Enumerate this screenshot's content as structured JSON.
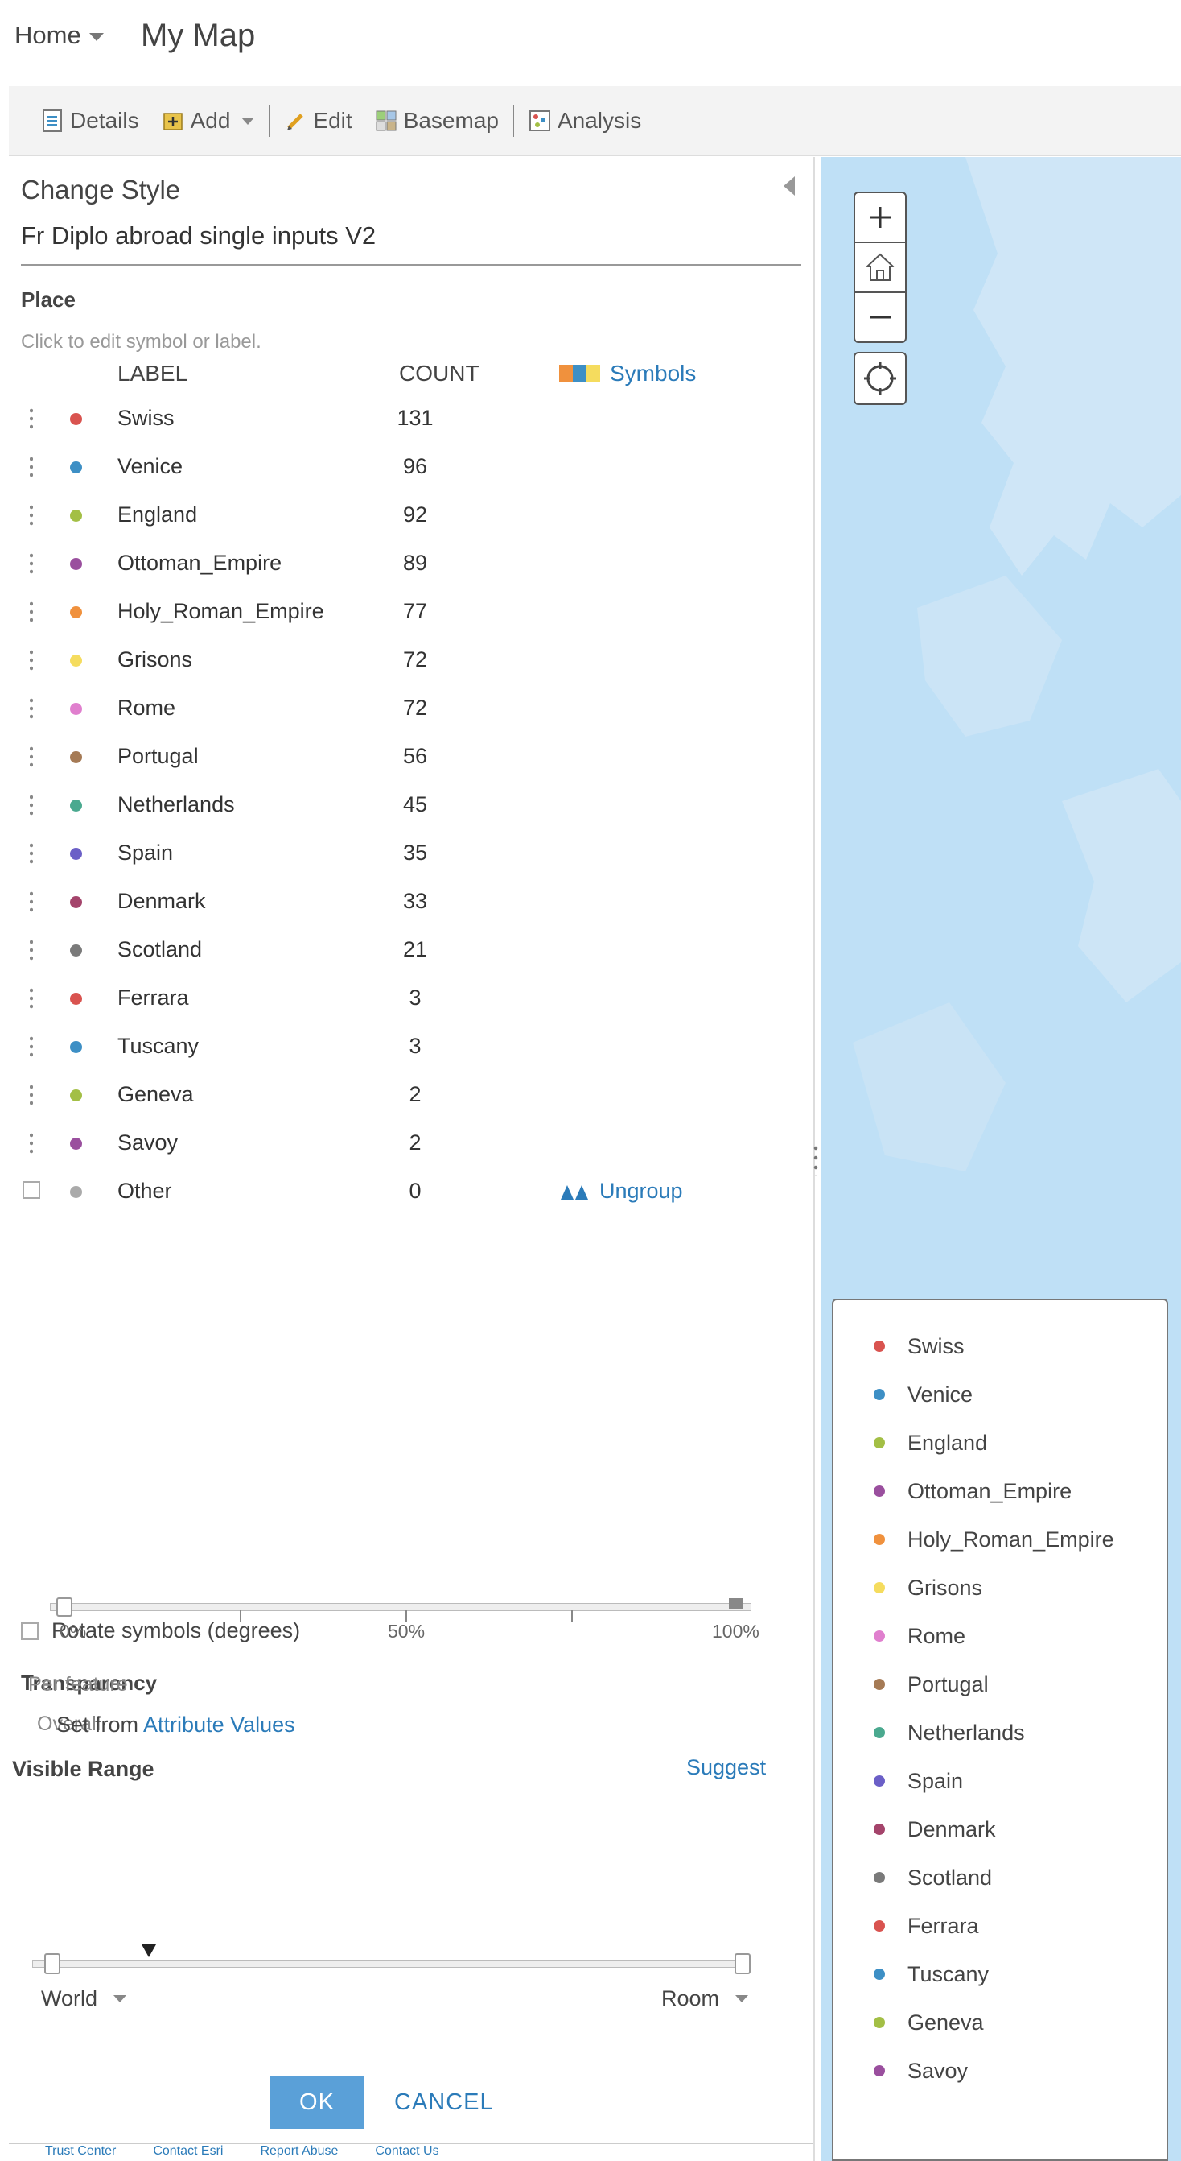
{
  "header": {
    "home": "Home",
    "title": "My Map"
  },
  "toolbar": {
    "details": "Details",
    "add": "Add",
    "edit": "Edit",
    "basemap": "Basemap",
    "analysis": "Analysis"
  },
  "panel": {
    "heading": "Change Style",
    "layer_name": "Fr Diplo abroad single inputs V2",
    "attribute": "Place",
    "hint": "Click to edit symbol or label.",
    "col_label": "LABEL",
    "col_count": "COUNT",
    "symbols": "Symbols",
    "ungroup": "Ungroup",
    "categories": [
      {
        "label": "Swiss",
        "count": "131",
        "color": "#d9534f"
      },
      {
        "label": "Venice",
        "count": "96",
        "color": "#3d8fc5"
      },
      {
        "label": "England",
        "count": "92",
        "color": "#a3bf45"
      },
      {
        "label": "Ottoman_Empire",
        "count": "89",
        "color": "#9a4f9e"
      },
      {
        "label": "Holy_Roman_Empire",
        "count": "77",
        "color": "#f0913d"
      },
      {
        "label": "Grisons",
        "count": "72",
        "color": "#f5dc5e"
      },
      {
        "label": "Rome",
        "count": "72",
        "color": "#e07fce"
      },
      {
        "label": "Portugal",
        "count": "56",
        "color": "#a57a55"
      },
      {
        "label": "Netherlands",
        "count": "45",
        "color": "#4aa98f"
      },
      {
        "label": "Spain",
        "count": "35",
        "color": "#6b5fc7"
      },
      {
        "label": "Denmark",
        "count": "33",
        "color": "#a4446b"
      },
      {
        "label": "Scotland",
        "count": "21",
        "color": "#7a7a7a"
      },
      {
        "label": "Ferrara",
        "count": "3",
        "color": "#d9534f"
      },
      {
        "label": "Tuscany",
        "count": "3",
        "color": "#3d8fc5"
      },
      {
        "label": "Geneva",
        "count": "2",
        "color": "#a3bf45"
      },
      {
        "label": "Savoy",
        "count": "2",
        "color": "#9a4f9e"
      }
    ],
    "other": {
      "label": "Other",
      "count": "0",
      "color": "#aaaaaa"
    },
    "rotate": "Rotate symbols (degrees)",
    "transparency": "Transparency",
    "overall": "Overall",
    "overall_value_pct": 0,
    "pct_labels": [
      "0%",
      "50%",
      "100%"
    ],
    "per_feature": "Per feature",
    "set_from": "Set from",
    "attribute_values": "Attribute Values",
    "visible_range": "Visible Range",
    "suggest": "Suggest",
    "range_min": "World",
    "range_max": "Room",
    "ok": "OK",
    "cancel": "CANCEL"
  },
  "footer": [
    "Trust Center",
    "Contact Esri",
    "Report Abuse",
    "Contact Us"
  ],
  "legend": {
    "items": [
      "Swiss",
      "Venice",
      "England",
      "Ottoman_Empire",
      "Holy_Roman_Empire",
      "Grisons",
      "Rome",
      "Portugal",
      "Netherlands",
      "Spain",
      "Denmark",
      "Scotland",
      "Ferrara",
      "Tuscany",
      "Geneva",
      "Savoy"
    ]
  },
  "colors": {
    "accent": "#2b7bb9",
    "ok_button": "#5aa0d8",
    "map_water": "#bfe0f6"
  }
}
